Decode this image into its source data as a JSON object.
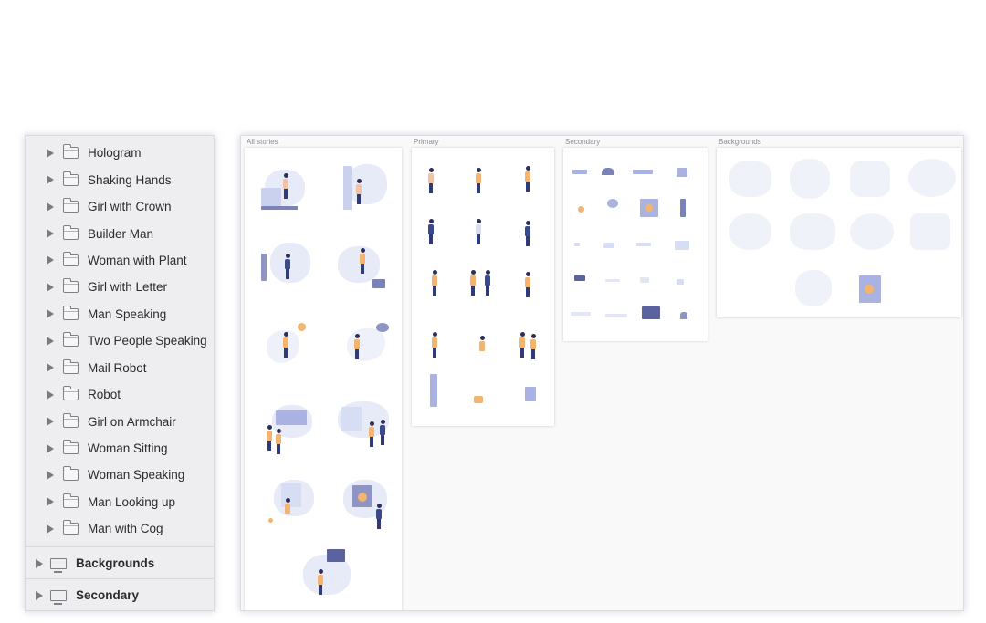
{
  "sidebar": {
    "items": [
      {
        "label": "Hologram"
      },
      {
        "label": "Shaking Hands"
      },
      {
        "label": "Girl with Crown"
      },
      {
        "label": "Builder Man"
      },
      {
        "label": "Woman with Plant"
      },
      {
        "label": "Girl with Letter"
      },
      {
        "label": "Man Speaking"
      },
      {
        "label": "Two People Speaking"
      },
      {
        "label": "Mail Robot"
      },
      {
        "label": "Robot"
      },
      {
        "label": "Girl on Armchair"
      },
      {
        "label": "Woman Sitting"
      },
      {
        "label": "Woman Speaking"
      },
      {
        "label": "Man Looking up"
      },
      {
        "label": "Man with Cog"
      }
    ],
    "groups": [
      {
        "label": "Backgrounds"
      },
      {
        "label": "Secondary"
      }
    ]
  },
  "canvas": {
    "artboards": [
      {
        "title": "All stories"
      },
      {
        "title": "Primary"
      },
      {
        "title": "Secondary"
      },
      {
        "title": "Backgrounds"
      }
    ]
  },
  "colors": {
    "accent_orange": "#f2b46f",
    "navy": "#2e3a7a",
    "light_blue": "#e6ebf7"
  }
}
